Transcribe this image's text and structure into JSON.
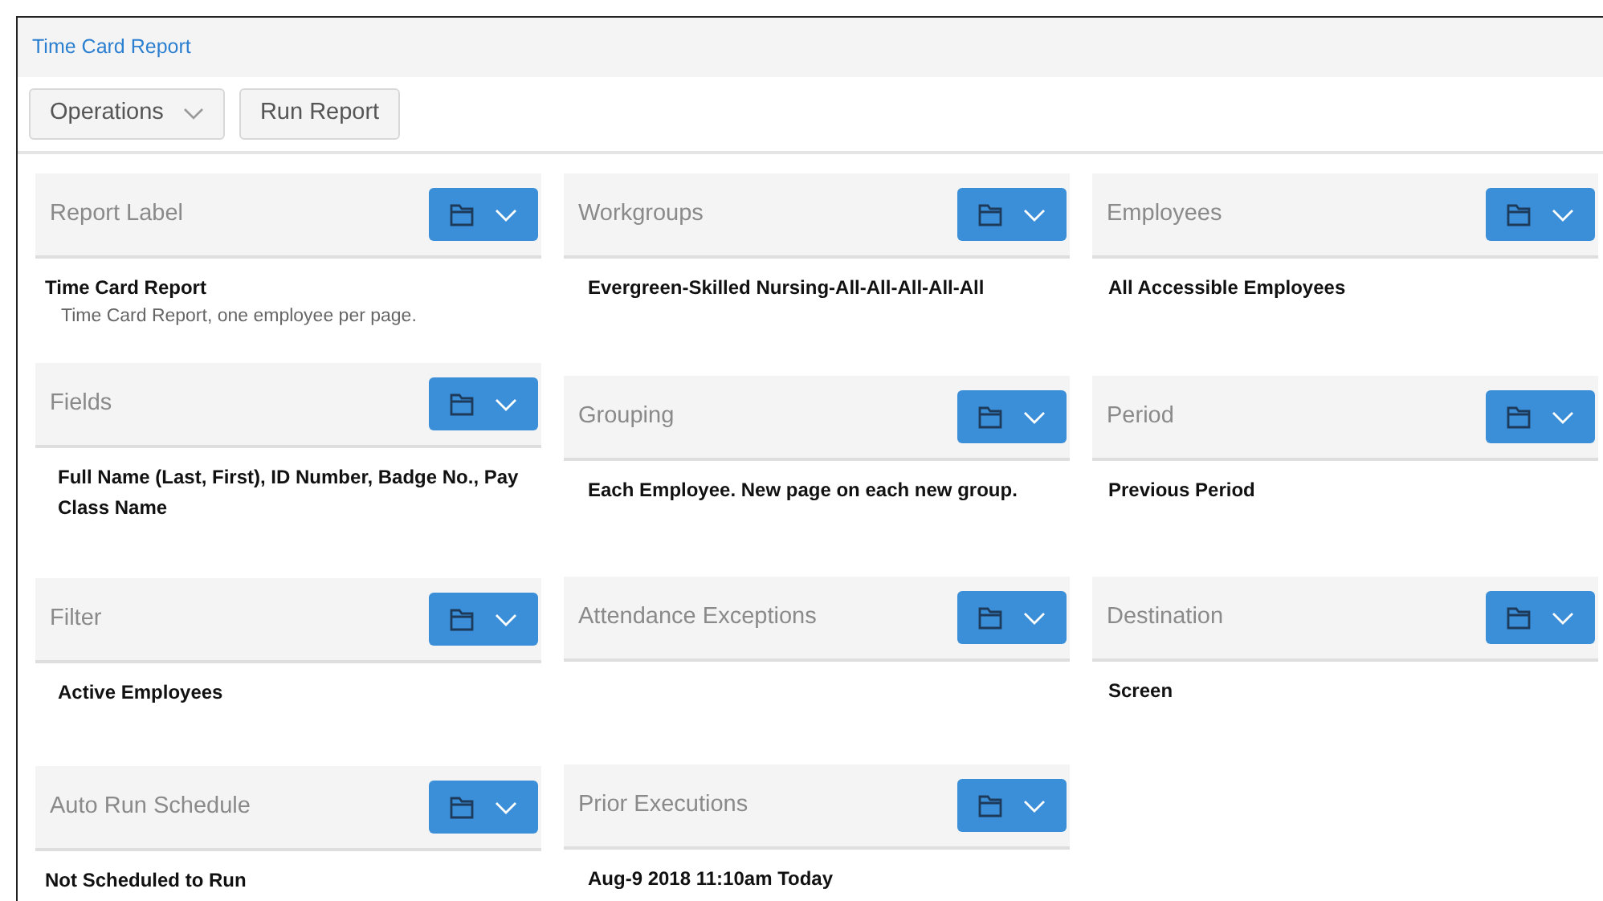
{
  "window": {
    "title": "Time Card Report"
  },
  "toolbar": [
    {
      "label": "Operations",
      "kind": "dropdown"
    },
    {
      "label": "Run Report",
      "kind": "button"
    }
  ],
  "columns": [
    {
      "cards": [
        {
          "title": "Report Label",
          "value": "Time Card Report",
          "description": "Time Card Report, one employee per page."
        },
        {
          "title": "Fields",
          "value": "Full Name (Last, First), ID Number, Badge No., Pay Class Name"
        },
        {
          "title": "Filter",
          "value": "Active Employees"
        },
        {
          "title": "Auto Run Schedule",
          "value": "Not Scheduled to Run"
        }
      ]
    },
    {
      "cards": [
        {
          "title": "Workgroups",
          "value": "Evergreen-Skilled Nursing-All-All-All-All-All"
        },
        {
          "title": "Grouping",
          "value": "Each Employee. New page on each new group."
        },
        {
          "title": "Attendance Exceptions"
        },
        {
          "title": "Prior Executions",
          "value": "Aug-9 2018 11:10am Today"
        }
      ]
    },
    {
      "cards": [
        {
          "title": "Employees",
          "value": "All Accessible Employees"
        },
        {
          "title": "Period",
          "value": "Previous Period"
        },
        {
          "title": "Destination",
          "value": "Screen"
        }
      ]
    }
  ]
}
